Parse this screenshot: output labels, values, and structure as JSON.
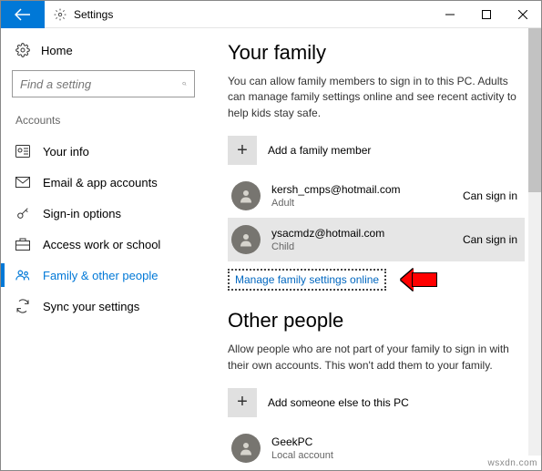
{
  "titlebar": {
    "title": "Settings"
  },
  "sidebar": {
    "home": "Home",
    "search_placeholder": "Find a setting",
    "category": "Accounts",
    "items": [
      {
        "label": "Your info"
      },
      {
        "label": "Email & app accounts"
      },
      {
        "label": "Sign-in options"
      },
      {
        "label": "Access work or school"
      },
      {
        "label": "Family & other people"
      },
      {
        "label": "Sync your settings"
      }
    ]
  },
  "family": {
    "heading": "Your family",
    "description": "You can allow family members to sign in to this PC. Adults can manage family settings online and see recent activity to help kids stay safe.",
    "add_label": "Add a family member",
    "members": [
      {
        "email": "kersh_cmps@hotmail.com",
        "role": "Adult",
        "status": "Can sign in"
      },
      {
        "email": "ysacmdz@hotmail.com",
        "role": "Child",
        "status": "Can sign in"
      }
    ],
    "link": "Manage family settings online"
  },
  "other": {
    "heading": "Other people",
    "description": "Allow people who are not part of your family to sign in with their own accounts. This won't add them to your family.",
    "add_label": "Add someone else to this PC",
    "users": [
      {
        "name": "GeekPC",
        "role": "Local account"
      }
    ]
  },
  "watermark": "wsxdn.com"
}
